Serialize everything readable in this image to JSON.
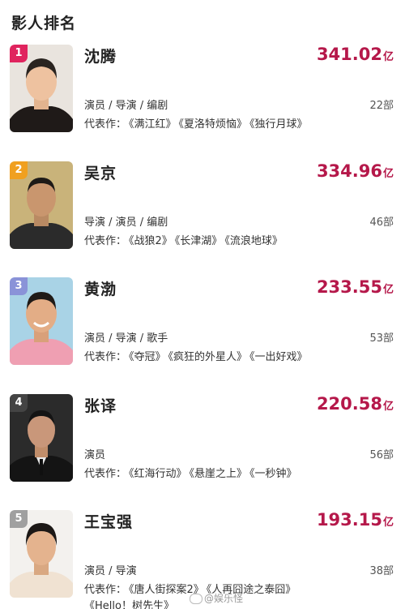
{
  "section_title": "影人排名",
  "colors": {
    "accent": "#b5184a",
    "rank1": "#e0245e",
    "rank2": "#f0a020",
    "rank3": "#8a93d8",
    "rank4": "#444444",
    "rank5": "#a0a0a0"
  },
  "rankings": [
    {
      "rank": "1",
      "name": "沈腾",
      "box_office": "341.02",
      "unit": "亿",
      "roles": "演员 / 导演 / 编剧",
      "works_count": "22部",
      "works_label": "代表作：",
      "works": [
        "《满江红》",
        "《夏洛特烦恼》",
        "《独行月球》"
      ]
    },
    {
      "rank": "2",
      "name": "吴京",
      "box_office": "334.96",
      "unit": "亿",
      "roles": "导演 / 演员 / 编剧",
      "works_count": "46部",
      "works_label": "代表作：",
      "works": [
        "《战狼2》",
        "《长津湖》",
        "《流浪地球》"
      ]
    },
    {
      "rank": "3",
      "name": "黄渤",
      "box_office": "233.55",
      "unit": "亿",
      "roles": "演员 / 导演 / 歌手",
      "works_count": "53部",
      "works_label": "代表作：",
      "works": [
        "《夺冠》",
        "《疯狂的外星人》",
        "《一出好戏》"
      ]
    },
    {
      "rank": "4",
      "name": "张译",
      "box_office": "220.58",
      "unit": "亿",
      "roles": "演员",
      "works_count": "56部",
      "works_label": "代表作：",
      "works": [
        "《红海行动》",
        "《悬崖之上》",
        "《一秒钟》"
      ]
    },
    {
      "rank": "5",
      "name": "王宝强",
      "box_office": "193.15",
      "unit": "亿",
      "roles": "演员 / 导演",
      "works_count": "38部",
      "works_label": "代表作：",
      "works": [
        "《唐人街探案2》",
        "《人再囧途之泰囧》",
        "《Hello！树先生》"
      ]
    }
  ],
  "watermark": "@娱乐怪"
}
